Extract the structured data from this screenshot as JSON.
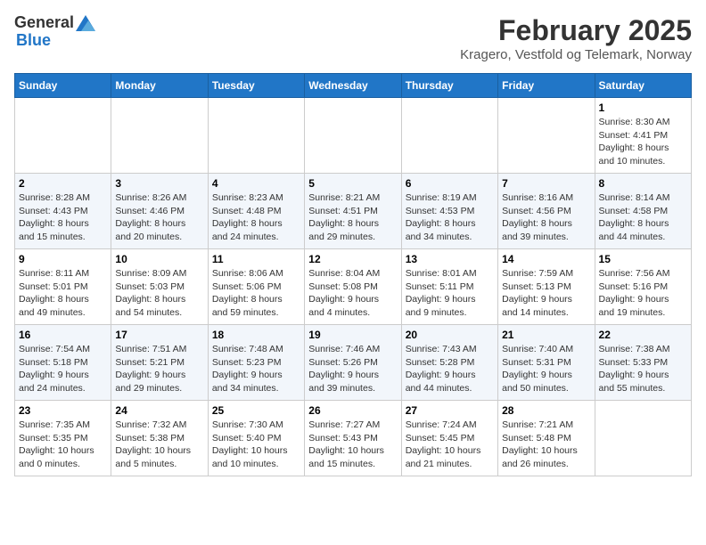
{
  "header": {
    "logo_general": "General",
    "logo_blue": "Blue",
    "month": "February 2025",
    "location": "Kragero, Vestfold og Telemark, Norway"
  },
  "weekdays": [
    "Sunday",
    "Monday",
    "Tuesday",
    "Wednesday",
    "Thursday",
    "Friday",
    "Saturday"
  ],
  "weeks": [
    [
      {
        "day": "",
        "info": ""
      },
      {
        "day": "",
        "info": ""
      },
      {
        "day": "",
        "info": ""
      },
      {
        "day": "",
        "info": ""
      },
      {
        "day": "",
        "info": ""
      },
      {
        "day": "",
        "info": ""
      },
      {
        "day": "1",
        "info": "Sunrise: 8:30 AM\nSunset: 4:41 PM\nDaylight: 8 hours\nand 10 minutes."
      }
    ],
    [
      {
        "day": "2",
        "info": "Sunrise: 8:28 AM\nSunset: 4:43 PM\nDaylight: 8 hours\nand 15 minutes."
      },
      {
        "day": "3",
        "info": "Sunrise: 8:26 AM\nSunset: 4:46 PM\nDaylight: 8 hours\nand 20 minutes."
      },
      {
        "day": "4",
        "info": "Sunrise: 8:23 AM\nSunset: 4:48 PM\nDaylight: 8 hours\nand 24 minutes."
      },
      {
        "day": "5",
        "info": "Sunrise: 8:21 AM\nSunset: 4:51 PM\nDaylight: 8 hours\nand 29 minutes."
      },
      {
        "day": "6",
        "info": "Sunrise: 8:19 AM\nSunset: 4:53 PM\nDaylight: 8 hours\nand 34 minutes."
      },
      {
        "day": "7",
        "info": "Sunrise: 8:16 AM\nSunset: 4:56 PM\nDaylight: 8 hours\nand 39 minutes."
      },
      {
        "day": "8",
        "info": "Sunrise: 8:14 AM\nSunset: 4:58 PM\nDaylight: 8 hours\nand 44 minutes."
      }
    ],
    [
      {
        "day": "9",
        "info": "Sunrise: 8:11 AM\nSunset: 5:01 PM\nDaylight: 8 hours\nand 49 minutes."
      },
      {
        "day": "10",
        "info": "Sunrise: 8:09 AM\nSunset: 5:03 PM\nDaylight: 8 hours\nand 54 minutes."
      },
      {
        "day": "11",
        "info": "Sunrise: 8:06 AM\nSunset: 5:06 PM\nDaylight: 8 hours\nand 59 minutes."
      },
      {
        "day": "12",
        "info": "Sunrise: 8:04 AM\nSunset: 5:08 PM\nDaylight: 9 hours\nand 4 minutes."
      },
      {
        "day": "13",
        "info": "Sunrise: 8:01 AM\nSunset: 5:11 PM\nDaylight: 9 hours\nand 9 minutes."
      },
      {
        "day": "14",
        "info": "Sunrise: 7:59 AM\nSunset: 5:13 PM\nDaylight: 9 hours\nand 14 minutes."
      },
      {
        "day": "15",
        "info": "Sunrise: 7:56 AM\nSunset: 5:16 PM\nDaylight: 9 hours\nand 19 minutes."
      }
    ],
    [
      {
        "day": "16",
        "info": "Sunrise: 7:54 AM\nSunset: 5:18 PM\nDaylight: 9 hours\nand 24 minutes."
      },
      {
        "day": "17",
        "info": "Sunrise: 7:51 AM\nSunset: 5:21 PM\nDaylight: 9 hours\nand 29 minutes."
      },
      {
        "day": "18",
        "info": "Sunrise: 7:48 AM\nSunset: 5:23 PM\nDaylight: 9 hours\nand 34 minutes."
      },
      {
        "day": "19",
        "info": "Sunrise: 7:46 AM\nSunset: 5:26 PM\nDaylight: 9 hours\nand 39 minutes."
      },
      {
        "day": "20",
        "info": "Sunrise: 7:43 AM\nSunset: 5:28 PM\nDaylight: 9 hours\nand 44 minutes."
      },
      {
        "day": "21",
        "info": "Sunrise: 7:40 AM\nSunset: 5:31 PM\nDaylight: 9 hours\nand 50 minutes."
      },
      {
        "day": "22",
        "info": "Sunrise: 7:38 AM\nSunset: 5:33 PM\nDaylight: 9 hours\nand 55 minutes."
      }
    ],
    [
      {
        "day": "23",
        "info": "Sunrise: 7:35 AM\nSunset: 5:35 PM\nDaylight: 10 hours\nand 0 minutes."
      },
      {
        "day": "24",
        "info": "Sunrise: 7:32 AM\nSunset: 5:38 PM\nDaylight: 10 hours\nand 5 minutes."
      },
      {
        "day": "25",
        "info": "Sunrise: 7:30 AM\nSunset: 5:40 PM\nDaylight: 10 hours\nand 10 minutes."
      },
      {
        "day": "26",
        "info": "Sunrise: 7:27 AM\nSunset: 5:43 PM\nDaylight: 10 hours\nand 15 minutes."
      },
      {
        "day": "27",
        "info": "Sunrise: 7:24 AM\nSunset: 5:45 PM\nDaylight: 10 hours\nand 21 minutes."
      },
      {
        "day": "28",
        "info": "Sunrise: 7:21 AM\nSunset: 5:48 PM\nDaylight: 10 hours\nand 26 minutes."
      },
      {
        "day": "",
        "info": ""
      }
    ]
  ]
}
